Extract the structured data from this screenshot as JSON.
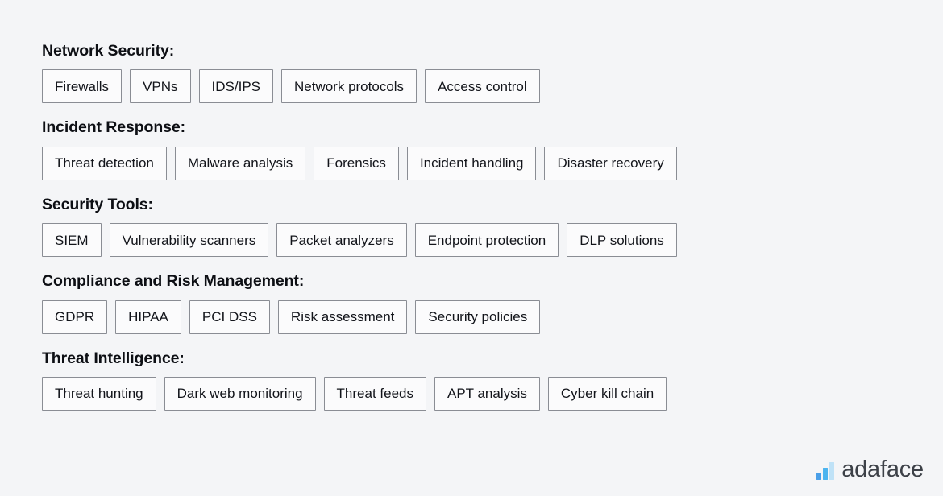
{
  "page": {
    "background_color": "#f4f5f7",
    "text_color": "#12141a"
  },
  "sections": [
    {
      "id": "network-security",
      "heading": "Network Security:",
      "chips": [
        "Firewalls",
        "VPNs",
        "IDS/IPS",
        "Network protocols",
        "Access control"
      ]
    },
    {
      "id": "incident-response",
      "heading": "Incident Response:",
      "chips": [
        "Threat detection",
        "Malware analysis",
        "Forensics",
        "Incident handling",
        "Disaster recovery"
      ]
    },
    {
      "id": "security-tools",
      "heading": "Security Tools:",
      "chips": [
        "SIEM",
        "Vulnerability scanners",
        "Packet analyzers",
        "Endpoint protection",
        "DLP solutions"
      ]
    },
    {
      "id": "compliance-and-risk-management",
      "heading": "Compliance and Risk Management:",
      "chips": [
        "GDPR",
        "HIPAA",
        "PCI DSS",
        "Risk assessment",
        "Security policies"
      ]
    },
    {
      "id": "threat-intelligence",
      "heading": "Threat Intelligence:",
      "chips": [
        "Threat hunting",
        "Dark web monitoring",
        "Threat feeds",
        "APT analysis",
        "Cyber kill chain"
      ]
    }
  ],
  "brand": {
    "name": "adaface",
    "icon": "bar-chart-logo-icon",
    "bar_colors": [
      "#4a9fe8",
      "#4cb4ef",
      "#bfe2f7"
    ],
    "text_color": "#3d4148"
  }
}
